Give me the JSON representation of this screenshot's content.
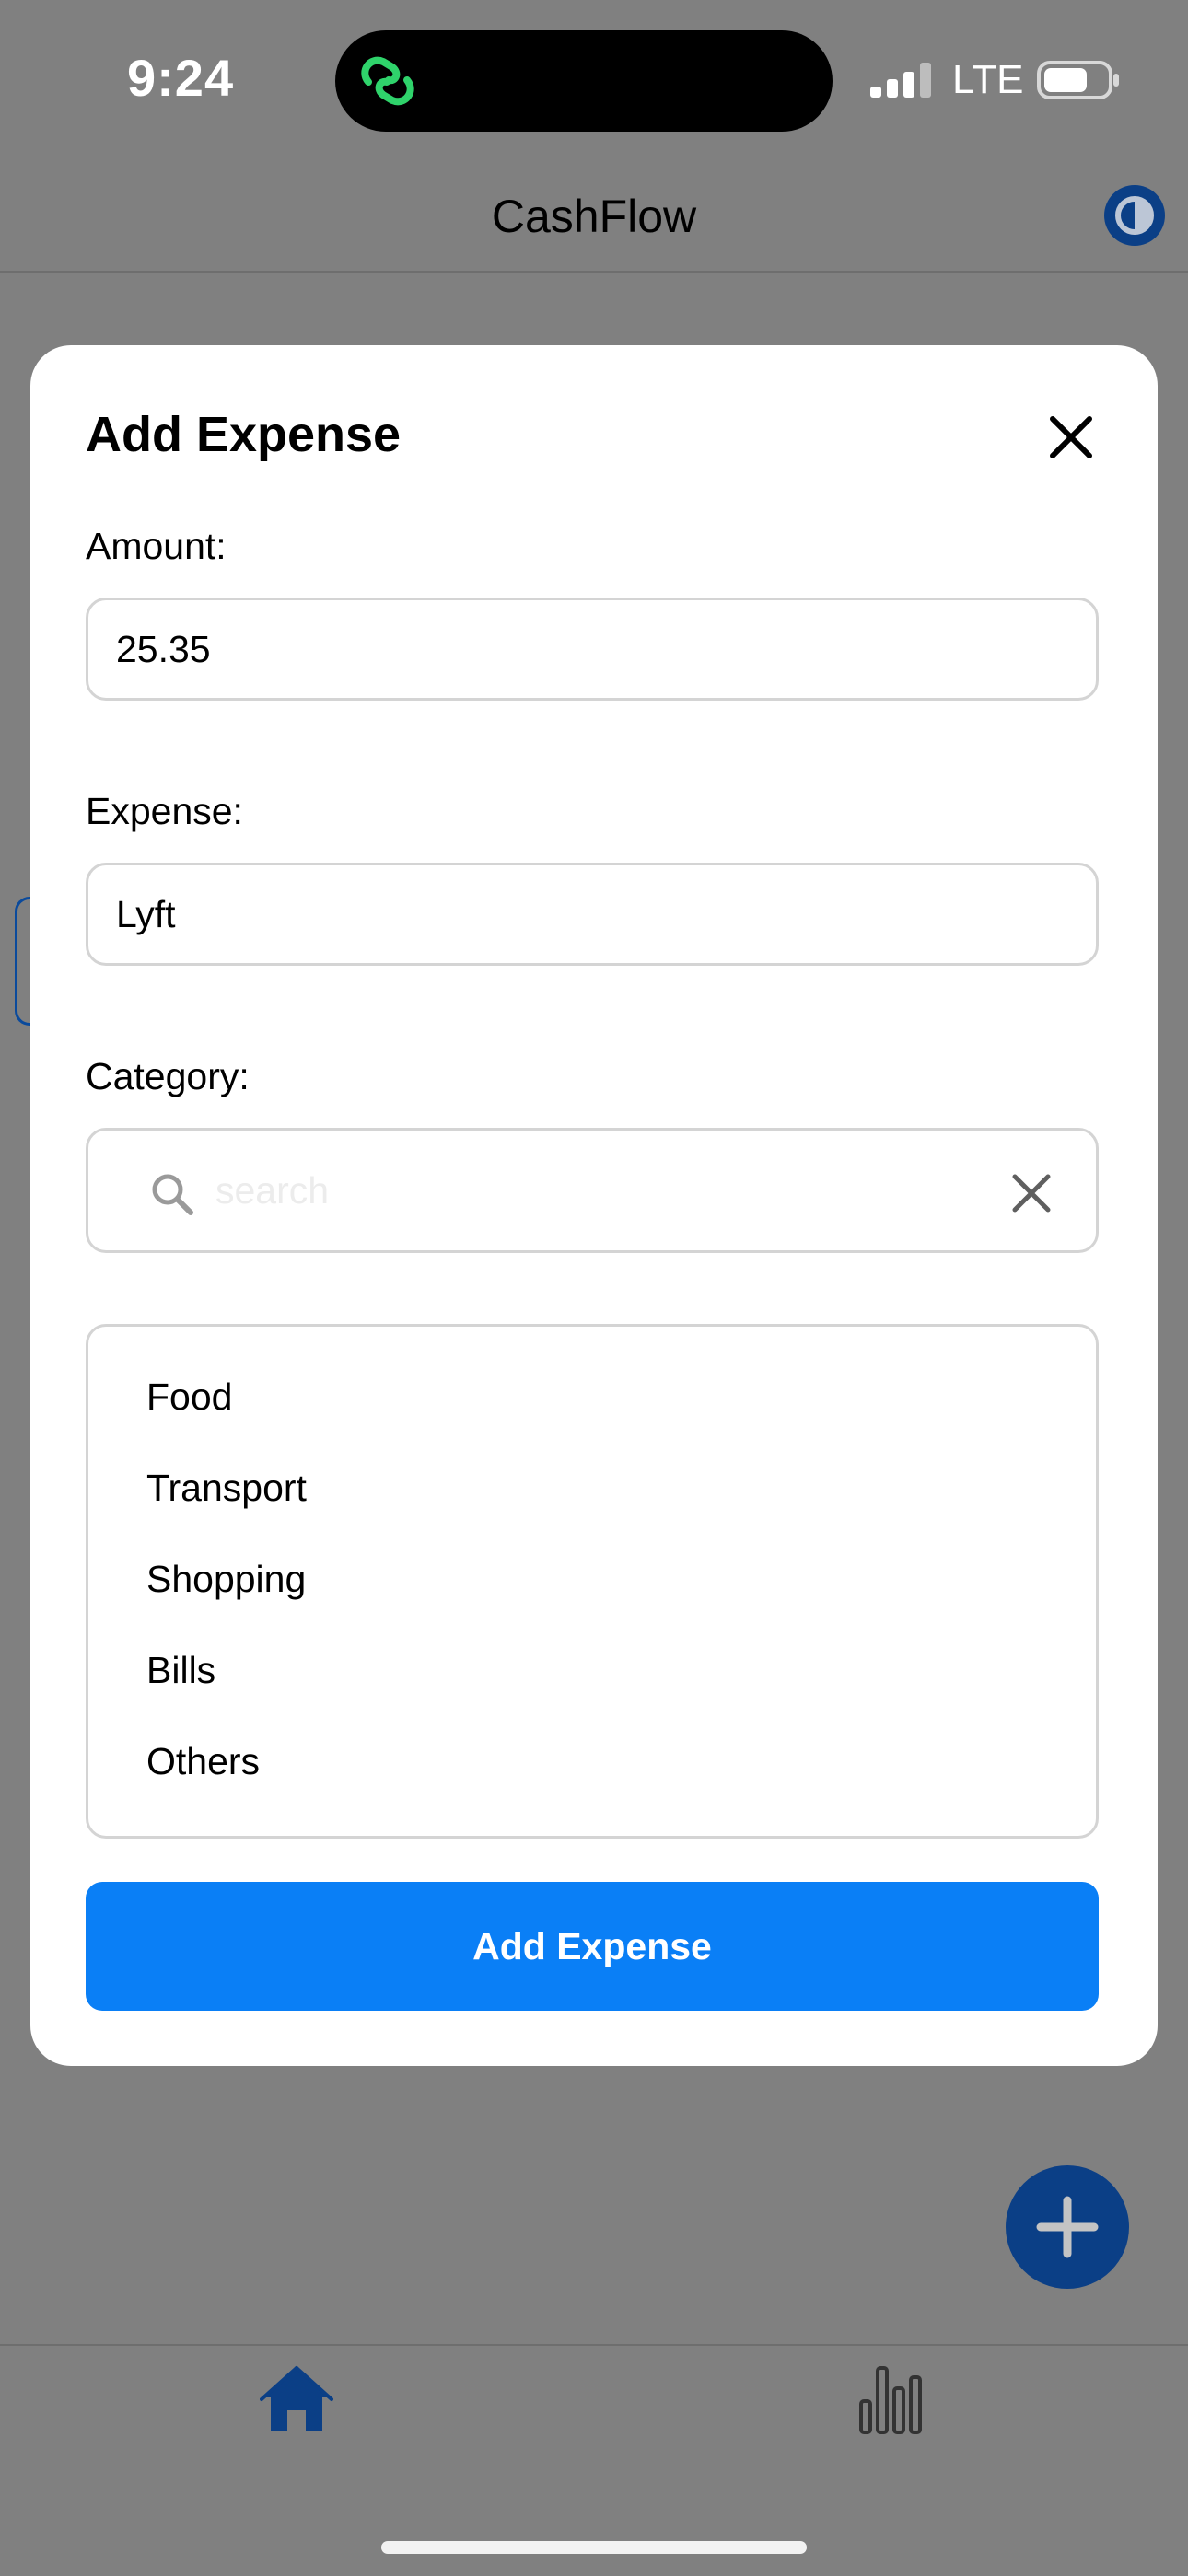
{
  "status_bar": {
    "time": "9:24",
    "network": "LTE"
  },
  "header": {
    "title": "CashFlow",
    "theme_icon": "contrast-icon"
  },
  "modal": {
    "title": "Add Expense",
    "close_icon": "close-icon",
    "amount": {
      "label": "Amount:",
      "value": "25.35"
    },
    "expense": {
      "label": "Expense:",
      "value": "Lyft"
    },
    "category": {
      "label": "Category:",
      "search_placeholder": "search",
      "options": [
        "Food",
        "Transport",
        "Shopping",
        "Bills",
        "Others"
      ]
    },
    "submit_label": "Add Expense"
  },
  "tab_bar": {
    "items": [
      {
        "icon": "home-icon"
      },
      {
        "icon": "bar-chart-icon"
      }
    ]
  },
  "colors": {
    "accent": "#0a7ff6",
    "brand_dark": "#0b3f86",
    "overlay": "#808080",
    "island_icon": "#2fd36b"
  }
}
